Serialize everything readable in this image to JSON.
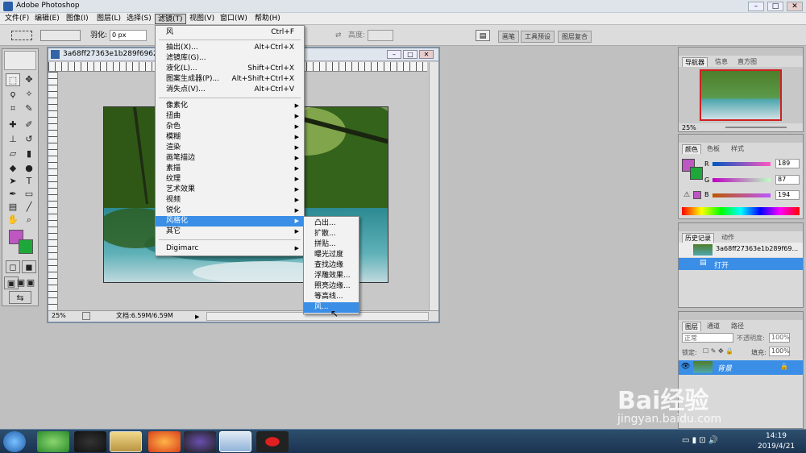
{
  "app": {
    "title": "Adobe Photoshop",
    "controls": [
      "–",
      "□",
      "✕"
    ]
  },
  "menubar": [
    {
      "label": "文件(F)"
    },
    {
      "label": "编辑(E)"
    },
    {
      "label": "图像(I)"
    },
    {
      "label": "图层(L)"
    },
    {
      "label": "选择(S)"
    },
    {
      "label": "滤镜(T)"
    },
    {
      "label": "视图(V)"
    },
    {
      "label": "窗口(W)"
    },
    {
      "label": "帮助(H)"
    }
  ],
  "options": {
    "feather_label": "羽化:",
    "feather_value": "0 px",
    "height_label": "高度:",
    "wells": [
      "画笔",
      "工具预设",
      "图层复合"
    ]
  },
  "document": {
    "title": "3a68ff27363e1b289f6962",
    "zoom": "25%",
    "doc_size": "文档:6.59M/6.59M"
  },
  "filter_menu": {
    "top": [
      {
        "label": "风",
        "shortcut": "Ctrl+F"
      }
    ],
    "group1": [
      {
        "label": "抽出(X)...",
        "shortcut": "Alt+Ctrl+X"
      },
      {
        "label": "滤镜库(G)...",
        "shortcut": ""
      },
      {
        "label": "液化(L)...",
        "shortcut": "Shift+Ctrl+X"
      },
      {
        "label": "图案生成器(P)...",
        "shortcut": "Alt+Shift+Ctrl+X"
      },
      {
        "label": "消失点(V)...",
        "shortcut": "Alt+Ctrl+V"
      }
    ],
    "group2": [
      {
        "label": "像素化"
      },
      {
        "label": "扭曲"
      },
      {
        "label": "杂色"
      },
      {
        "label": "模糊"
      },
      {
        "label": "渲染"
      },
      {
        "label": "画笔描边"
      },
      {
        "label": "素描"
      },
      {
        "label": "纹理"
      },
      {
        "label": "艺术效果"
      },
      {
        "label": "视频"
      },
      {
        "label": "锐化"
      },
      {
        "label": "风格化"
      },
      {
        "label": "其它"
      }
    ],
    "group3": [
      {
        "label": "Digimarc"
      }
    ]
  },
  "stylize_submenu": [
    {
      "label": "凸出..."
    },
    {
      "label": "扩散..."
    },
    {
      "label": "拼贴..."
    },
    {
      "label": "曝光过度"
    },
    {
      "label": "查找边缘"
    },
    {
      "label": "浮雕效果..."
    },
    {
      "label": "照亮边缘..."
    },
    {
      "label": "等高线..."
    },
    {
      "label": "风..."
    }
  ],
  "navigator": {
    "tabs": [
      "导航器",
      "信息",
      "直方图"
    ],
    "zoom": "25%"
  },
  "color_panel": {
    "tabs": [
      "颜色",
      "色板",
      "样式"
    ],
    "r_label": "R",
    "r_value": "189",
    "g_label": "G",
    "g_value": "87",
    "b_label": "B",
    "b_value": "194",
    "foreground": "#bd57c2",
    "background": "#1fa83a"
  },
  "history_panel": {
    "tabs": [
      "历史记录",
      "动作"
    ],
    "snapshot": "3a68ff27363e1b289f69...",
    "state": "打开"
  },
  "layers_panel": {
    "tabs": [
      "图层",
      "通道",
      "路径"
    ],
    "blend_mode": "正常",
    "opacity_label": "不透明度:",
    "opacity_value": "100%",
    "lock_label": "锁定:",
    "fill_label": "填充:",
    "fill_value": "100%",
    "layer_name": "背景"
  },
  "taskbar": {
    "time": "14:19",
    "date": "2019/4/21"
  },
  "watermark": {
    "brand": "Bai经验",
    "url": "jingyan.baidu.com"
  }
}
